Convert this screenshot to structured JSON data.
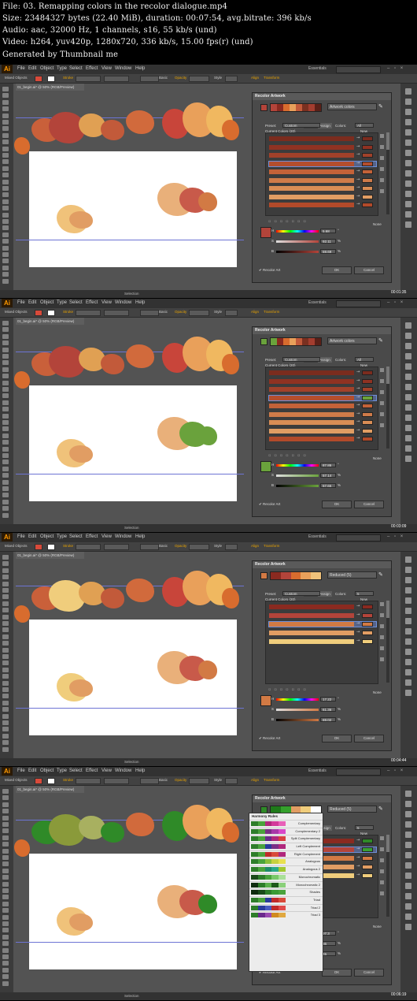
{
  "file_info": {
    "line1": "File: 03. Remapping colors in the recolor dialogue.mp4",
    "line2": "Size: 23484327 bytes (22.40 MiB), duration: 00:07:54, avg.bitrate: 396 kb/s",
    "line3": "Audio: aac, 32000 Hz, 1 channels, s16, 55 kb/s (und)",
    "line4": "Video: h264, yuv420p, 1280x720, 336 kb/s, 15.00 fps(r) (und)",
    "line5": "Generated by Thumbnail me"
  },
  "app": {
    "logo": "Ai",
    "menus": [
      "File",
      "Edit",
      "Object",
      "Type",
      "Select",
      "Effect",
      "View",
      "Window",
      "Help"
    ],
    "workspace": "Essentials",
    "control_bar": {
      "mixed": "Mixed Objects",
      "stroke": "Stroke",
      "basic": "Basic",
      "opacity": "Opacity",
      "style": "Style",
      "align": "Align",
      "transform": "Transform"
    },
    "doc_tab": "01_begin.ai* @ 50% (RGB/Preview)",
    "status_tool": "Selection",
    "window_buttons": "– ▫ ×"
  },
  "dialog": {
    "title": "Recolor Artwork",
    "tab_edit": "Edit",
    "tab_assign": "Assign",
    "preset_label": "Preset:",
    "preset_value": "Custom",
    "colors_label": "Colors:",
    "current_colors_label": "Current Colors (20)",
    "new_label": "New",
    "none_label": "None",
    "recolor_art": "Recolor Art",
    "ok": "OK",
    "cancel": "Cancel"
  },
  "frames": [
    {
      "timestamp": "00:01:35",
      "group_name": "Artwork colors",
      "colors_value": "All",
      "strip": [
        "#b3443a",
        "#8a2a20",
        "#d86c2e",
        "#e9a05a",
        "#c25a3a",
        "#7a3020",
        "#a33d2f",
        "#5a2018"
      ],
      "rows": [
        "#7b2c1e",
        "#8f3222",
        "#a1412a",
        "#b34e2e",
        "#c46238",
        "#cf7b49",
        "#d98d55",
        "#e19d63",
        "#b24a2a"
      ],
      "new_colors": [
        "#7b2c1e",
        "#8f3222",
        "#a1412a",
        "#b34e2e",
        "#c46238",
        "#cf7b49",
        "#d98d55",
        "#e19d63",
        "#b24a2a"
      ],
      "selected_row": 3,
      "main_swatch": "#b3443a",
      "h": "5.68",
      "s": "92.11",
      "b": "59.69",
      "h_unit": "°",
      "pct": "%"
    },
    {
      "timestamp": "00:03:09",
      "group_name": "Artwork colors",
      "colors_value": "All",
      "strip": [
        "#6aa23c",
        "#8a2a20",
        "#d86c2e",
        "#e9a05a",
        "#c25a3a",
        "#7a3020",
        "#a33d2f",
        "#5a2018"
      ],
      "rows": [
        "#7b2c1e",
        "#8f3222",
        "#a1412a",
        "#b34e2e",
        "#c46238",
        "#cf7b49",
        "#d98d55",
        "#e19d63",
        "#b24a2a"
      ],
      "new_colors": [
        "#7b2c1e",
        "#8f3222",
        "#a1412a",
        "#6aa23c",
        "#c46238",
        "#cf7b49",
        "#d98d55",
        "#e19d63",
        "#b24a2a"
      ],
      "selected_row": 3,
      "main_swatch": "#6aa23c",
      "h": "87.86",
      "s": "57.14",
      "b": "57.65",
      "h_unit": "°",
      "pct": "%"
    },
    {
      "timestamp": "00:04:44",
      "group_name": "Reduced (5)",
      "colors_value": "5",
      "strip": [
        "#8a2a20",
        "#b3443a",
        "#d86c2e",
        "#e9a05a",
        "#f0c27a"
      ],
      "rows": [
        "#8a2a20",
        "#b3443a",
        "#d27a44",
        "#e19d63",
        "#f0cd7c"
      ],
      "new_colors": [
        "#8a2a20",
        "#b3443a",
        "#d27a44",
        "#e19d63",
        "#f0cd7c"
      ],
      "selected_row": 2,
      "main_swatch": "#d27a44",
      "h": "17.22",
      "s": "61.36",
      "b": "69.02",
      "h_unit": "°",
      "pct": "%"
    },
    {
      "timestamp": "00:06:19",
      "group_name": "Reduced (5)",
      "colors_value": "5",
      "strip": [
        "#1f7a1a",
        "#34a02c",
        "#e19d63",
        "#f0cd7c",
        "#ffffff"
      ],
      "rows": [
        "#8a2a20",
        "#b3443a",
        "#d27a44",
        "#e19d63",
        "#f0cd7c"
      ],
      "new_colors": [
        "#2f8a28",
        "#3aa133",
        "#d27a44",
        "#e19d63",
        "#f0cd7c"
      ],
      "selected_row": 1,
      "main_swatch": "#2f8a28",
      "h": "97.3",
      "s": "86",
      "b": "45",
      "h_unit": "°",
      "pct": "%"
    }
  ],
  "harmony": {
    "title": "Harmony Rules",
    "rules": [
      {
        "name": "Complementary",
        "colors": [
          "#2e7d2a",
          "#4aa33c",
          "#b0287c",
          "#d33a9a",
          "#e860b8"
        ]
      },
      {
        "name": "Complementary 2",
        "colors": [
          "#2e7d2a",
          "#4aa33c",
          "#7a2f86",
          "#a838a8",
          "#d848c8"
        ]
      },
      {
        "name": "Split Complementary",
        "colors": [
          "#2e7d2a",
          "#4aa33c",
          "#6a2a8c",
          "#b0287c",
          "#d84040"
        ]
      },
      {
        "name": "Left Complement",
        "colors": [
          "#2e7d2a",
          "#4aa33c",
          "#2a3a9c",
          "#7a2f86",
          "#b0287c"
        ]
      },
      {
        "name": "Right Complement",
        "colors": [
          "#2e7d2a",
          "#4aa33c",
          "#c02a2a",
          "#d84a3a",
          "#b0287c"
        ]
      },
      {
        "name": "Analogous",
        "colors": [
          "#2e7d2a",
          "#4aa33c",
          "#8abf3a",
          "#c8d040",
          "#e8e050"
        ]
      },
      {
        "name": "Analogous 2",
        "colors": [
          "#2e7d2a",
          "#4aa33c",
          "#1e8a6a",
          "#2aa888",
          "#a0c830"
        ]
      },
      {
        "name": "Monochromatic",
        "colors": [
          "#1a4a1a",
          "#2e7d2a",
          "#4aa33c",
          "#78c868",
          "#a8e098"
        ]
      },
      {
        "name": "Monochromatic 2",
        "colors": [
          "#102e10",
          "#2e7d2a",
          "#5ab04c",
          "#1e5a1a",
          "#8ad07a"
        ]
      },
      {
        "name": "Shades",
        "colors": [
          "#0e2a0e",
          "#1a4a1a",
          "#2e7d2a",
          "#3a9a34",
          "#4aa33c"
        ]
      },
      {
        "name": "Triad",
        "colors": [
          "#2e7d2a",
          "#4aa33c",
          "#2a3a9c",
          "#c02a2a",
          "#d84a3a"
        ]
      },
      {
        "name": "Triad 2",
        "colors": [
          "#2e7d2a",
          "#2a3a9c",
          "#4a5ac0",
          "#c02a2a",
          "#e04a4a"
        ]
      },
      {
        "name": "Triad 3",
        "colors": [
          "#2e7d2a",
          "#6a2a8c",
          "#9a4ab0",
          "#d08a20",
          "#e0a840"
        ]
      }
    ]
  }
}
